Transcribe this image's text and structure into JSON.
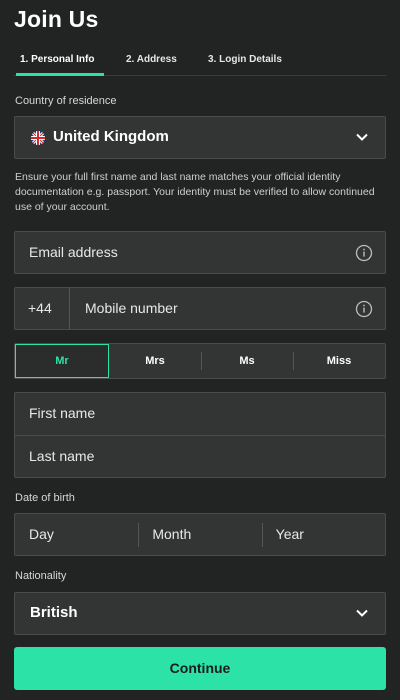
{
  "header": {
    "title": "Join Us"
  },
  "tabs": [
    {
      "label": "1.  Personal Info",
      "active": true
    },
    {
      "label": "2.  Address",
      "active": false
    },
    {
      "label": "3.  Login Details",
      "active": false
    }
  ],
  "country": {
    "label": "Country of residence",
    "value": "United Kingdom",
    "icon": "uk-flag-icon"
  },
  "helper_text": "Ensure your full first name and last name matches your official identity documentation e.g. passport. Your identity must be verified to allow continued use of your account.",
  "email": {
    "placeholder": "Email address",
    "icon": "info-icon"
  },
  "mobile": {
    "prefix": "+44",
    "placeholder": "Mobile number",
    "icon": "info-icon"
  },
  "titles": {
    "options": [
      "Mr",
      "Mrs",
      "Ms",
      "Miss"
    ],
    "selected": "Mr"
  },
  "name": {
    "first_placeholder": "First name",
    "last_placeholder": "Last name"
  },
  "dob": {
    "label": "Date of birth",
    "day": "Day",
    "month": "Month",
    "year": "Year"
  },
  "nationality": {
    "label": "Nationality",
    "value": "British"
  },
  "continue_label": "Continue",
  "colors": {
    "accent": "#2de2a6",
    "background": "#222323",
    "field": "#333434"
  }
}
